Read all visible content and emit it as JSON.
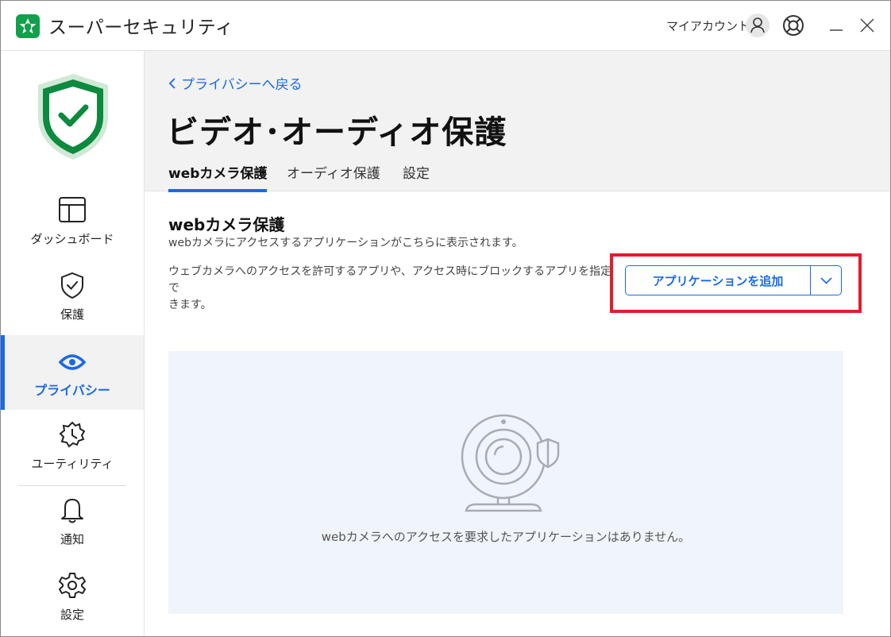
{
  "app": {
    "title": "スーパーセキュリティ",
    "account_label": "マイアカウント",
    "logo_icon": "star-shield-icon",
    "brand_color": "#12a04a"
  },
  "sidebar": {
    "status_icon": "shield-check-icon",
    "items": [
      {
        "label": "ダッシュボード",
        "icon": "dashboard-icon"
      },
      {
        "label": "保護",
        "icon": "shield-icon"
      },
      {
        "label": "プライバシー",
        "icon": "eye-icon",
        "active": true
      },
      {
        "label": "ユーティリティ",
        "icon": "utility-icon"
      },
      {
        "label": "通知",
        "icon": "bell-icon"
      },
      {
        "label": "設定",
        "icon": "gear-icon"
      }
    ]
  },
  "header": {
    "back_label": "プライバシーへ戻る",
    "page_title": "ビデオ･オーディオ保護",
    "tabs": [
      {
        "label": "webカメラ保護",
        "active": true
      },
      {
        "label": "オーディオ保護"
      },
      {
        "label": "設定"
      }
    ]
  },
  "main": {
    "section_title": "webカメラ保護",
    "section_subtitle": "webカメラにアクセスするアプリケーションがこちらに表示されます。",
    "description_line1": "ウェブカメラへのアクセスを許可するアプリや、アクセス時にブロックするアプリを指定で",
    "description_line2": "きます。",
    "add_button_label": "アプリケーションを追加",
    "empty_message": "webカメラへのアクセスを要求したアプリケーションはありません。",
    "accent_color": "#1a6ae6",
    "highlight_color": "#e31c2c"
  }
}
